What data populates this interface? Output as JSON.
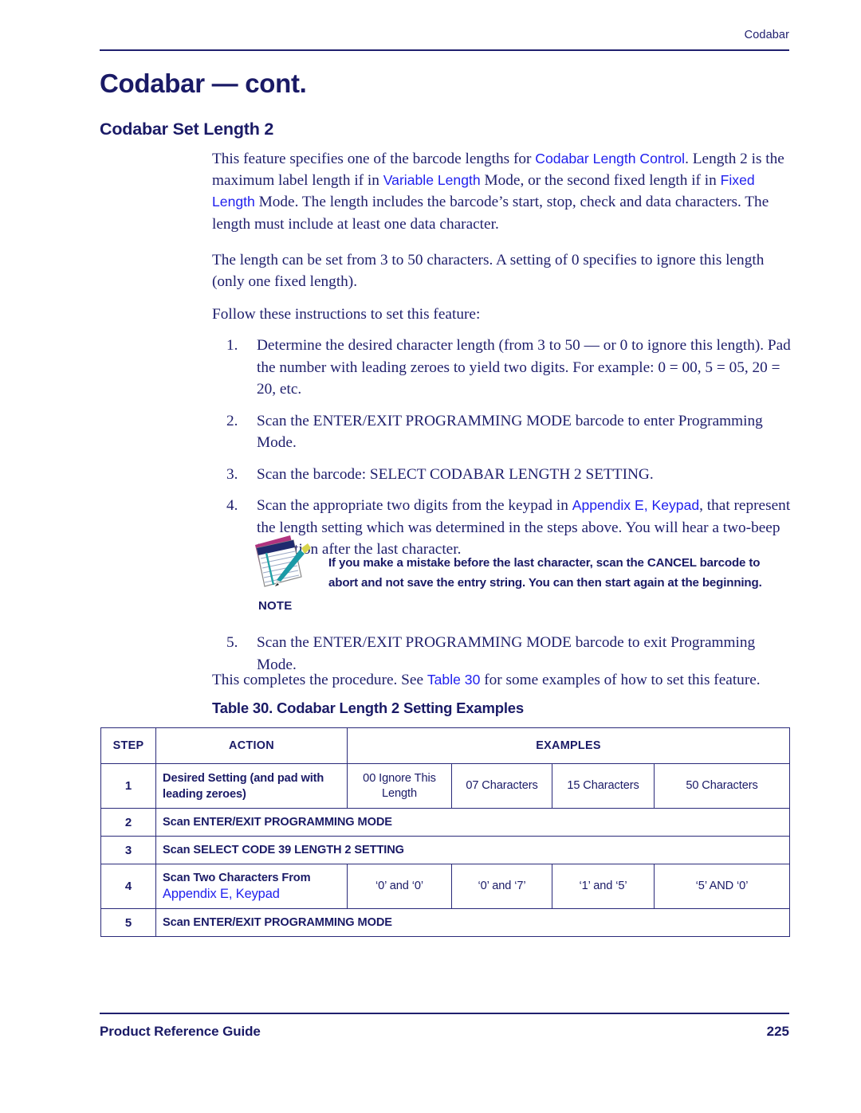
{
  "page": {
    "running_header": "Codabar",
    "footer_left": "Product Reference Guide",
    "footer_page_number": "225",
    "colors": {
      "navy_text": "#20206d",
      "heading_navy": "#1a1a66",
      "xref_blue": "#1f1fee",
      "rule": "#1f1f6e",
      "table_border": "#2a2a7a"
    }
  },
  "headings": {
    "h1": "Codabar — cont.",
    "h2": "Codabar Set Length 2"
  },
  "paragraphs": {
    "p1_part1": "This feature specifies one of the barcode lengths for ",
    "p1_xref1": "Codabar Length Control",
    "p1_part2": ". Length 2 is the maximum label length if in ",
    "p1_xref2": "Variable Length",
    "p1_part3": " Mode, or the second fixed length if in ",
    "p1_xref3": "Fixed Length",
    "p1_part4": " Mode. The length includes the barcode’s start, stop, check and data characters.  The length must include at least one data character.",
    "p2": "The length can be set from 3 to 50 characters. A setting of 0 specifies to ignore this length (only one fixed length).",
    "p3": "Follow these instructions to set this feature:",
    "p4_part1": "This completes the procedure. See ",
    "p4_xref": "Table 30",
    "p4_part2": " for some examples of how to set this feature."
  },
  "steps": [
    {
      "num": "1.",
      "text": "Determine the desired character length (from 3 to 50 — or 0 to ignore this length). Pad the number with leading zeroes to yield two digits. For example: 0 = 00, 5 = 05, 20 = 20, etc."
    },
    {
      "num": "2.",
      "text": "Scan the ENTER/EXIT PROGRAMMING MODE barcode to enter Programming Mode."
    },
    {
      "num": "3.",
      "text": "Scan the barcode: SELECT CODABAR LENGTH 2 SETTING."
    },
    {
      "num": "4.",
      "part1": "Scan the appropriate two digits from the keypad in ",
      "xref": "Appendix E, Keypad",
      "part2": ", that represent the length setting which was determined in the steps above. You will hear a two-beep indication after the last character."
    },
    {
      "num": "5.",
      "text": "Scan the ENTER/EXIT PROGRAMMING MODE barcode to exit Programming Mode."
    }
  ],
  "note": {
    "label": "NOTE",
    "icon": "notepad-pen-icon",
    "text": "If you make a mistake before the last character, scan the CANCEL barcode to abort and not save the entry string. You can then start again at the beginning."
  },
  "table": {
    "caption": "Table 30. Codabar Length 2 Setting Examples",
    "headers": [
      "STEP",
      "ACTION",
      "EXAMPLES"
    ],
    "rows": [
      {
        "step": "1",
        "action": "Desired Setting (and pad with leading zeroes)",
        "action_xref": "",
        "examples": [
          "00 Ignore This Length",
          "07 Characters",
          "15 Characters",
          "50 Characters"
        ]
      },
      {
        "step": "2",
        "action": "Scan ENTER/EXIT PROGRAMMING MODE",
        "action_xref": "",
        "examples": []
      },
      {
        "step": "3",
        "action": "Scan SELECT CODE 39 LENGTH 2 SETTING",
        "action_xref": "",
        "examples": []
      },
      {
        "step": "4",
        "action": "Scan Two Characters From",
        "action_xref": "Appendix E, Keypad",
        "examples": [
          "‘0’ and ‘0’",
          "‘0’ and ‘7’",
          "‘1’ and ‘5’",
          "‘5’ AND ‘0’"
        ]
      },
      {
        "step": "5",
        "action": "Scan ENTER/EXIT PROGRAMMING MODE",
        "action_xref": "",
        "examples": []
      }
    ]
  }
}
